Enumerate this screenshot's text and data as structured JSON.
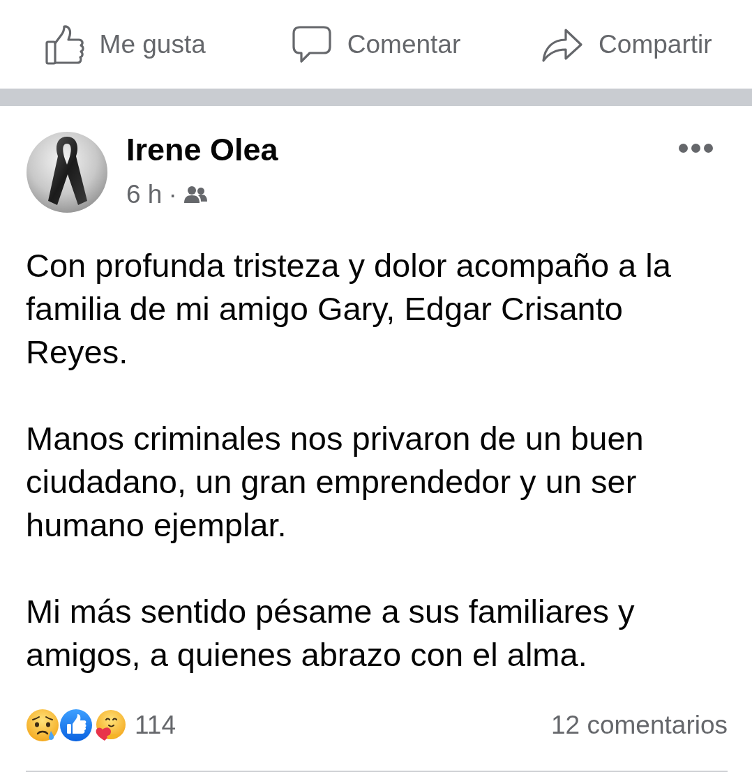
{
  "actions": [
    {
      "kind": "like",
      "label": "Me gusta"
    },
    {
      "kind": "comment",
      "label": "Comentar"
    },
    {
      "kind": "share",
      "label": "Compartir"
    }
  ],
  "post": {
    "author": "Irene Olea",
    "time": "6 h",
    "separator": "·",
    "paragraphs": [
      "Con profunda tristeza y dolor acompaño a la familia de mi amigo Gary, Edgar Crisanto Reyes.",
      "Manos criminales nos privaron de un buen ciudadano, un gran emprendedor y un ser humano ejemplar.",
      "Mi más sentido pésame a sus familiares y amigos, a quienes abrazo con el alma."
    ],
    "reactions": [
      {
        "kind": "sad"
      },
      {
        "kind": "like"
      },
      {
        "kind": "care"
      }
    ],
    "reaction_count": "114",
    "comments": "12 comentarios"
  }
}
